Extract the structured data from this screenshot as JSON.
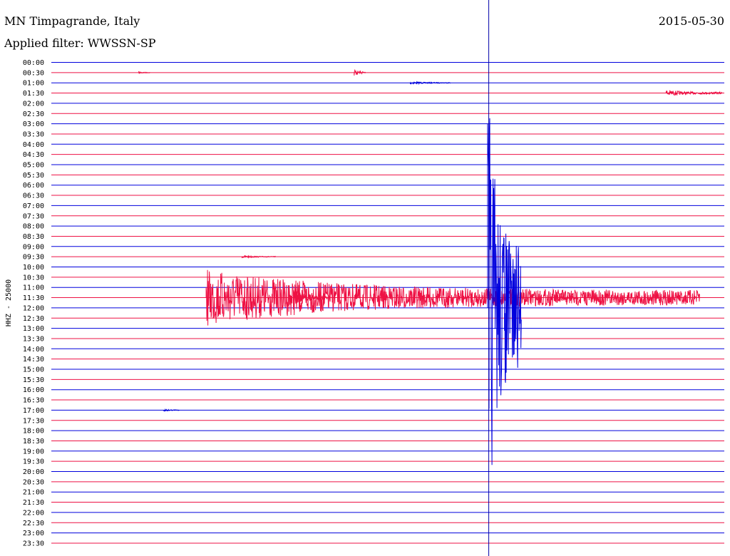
{
  "header": {
    "station": "MN Timpagrande, Italy",
    "date": "2015-05-30",
    "filter": "Applied filter: WWSSN-SP"
  },
  "chart_data": {
    "type": "line",
    "title": "MN Timpagrande, Italy",
    "date": "2015-05-30",
    "filter": "WWSSN-SP",
    "ylabel": "HHZ - 25000",
    "row_labels": [
      "00:00",
      "00:30",
      "01:00",
      "01:30",
      "02:00",
      "02:30",
      "03:00",
      "03:30",
      "04:00",
      "04:30",
      "05:00",
      "05:30",
      "06:00",
      "06:30",
      "07:00",
      "07:30",
      "08:00",
      "08:30",
      "09:00",
      "09:30",
      "10:00",
      "10:30",
      "11:00",
      "11:30",
      "12:00",
      "12:30",
      "13:00",
      "13:30",
      "14:00",
      "14:30",
      "15:00",
      "15:30",
      "16:00",
      "16:30",
      "17:00",
      "17:30",
      "18:00",
      "18:30",
      "19:00",
      "19:30",
      "20:00",
      "20:30",
      "21:00",
      "21:30",
      "22:00",
      "22:30",
      "23:00",
      "23:30"
    ],
    "x_range_minutes": [
      0,
      30
    ],
    "marker_minute": 19.5,
    "colors": {
      "odd_rows": "#0000dd",
      "even_rows": "#ee1144",
      "marker": "#0000aa"
    },
    "events": [
      {
        "row": "00:30",
        "minute": 3.9,
        "amplitude": 2,
        "duration_min": 0.5
      },
      {
        "row": "00:30",
        "minute": 13.5,
        "amplitude": 6,
        "duration_min": 0.5
      },
      {
        "row": "01:00",
        "minute": 16.0,
        "amplitude": 2,
        "duration_min": 1.8
      },
      {
        "row": "01:30",
        "minute": 27.4,
        "amplitude": 5,
        "duration_min": 2.5
      },
      {
        "row": "09:30",
        "minute": 8.5,
        "amplitude": 2,
        "duration_min": 1.5
      },
      {
        "row": "11:30",
        "minute": 6.9,
        "amplitude": 40,
        "duration_min": 22
      },
      {
        "row": "11:30",
        "minute": 22.5,
        "amplitude": 10,
        "duration_min": 1.0
      },
      {
        "row": "11:30",
        "minute": 10.8,
        "amplitude": 12,
        "duration_min": 1.5
      },
      {
        "row": "12:00",
        "minute": 19.45,
        "amplitude": 330,
        "duration_min": 1.5
      },
      {
        "row": "17:00",
        "minute": 5.0,
        "amplitude": 2,
        "duration_min": 0.7
      }
    ]
  }
}
